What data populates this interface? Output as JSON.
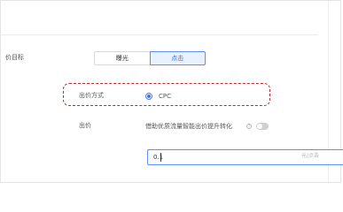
{
  "goal": {
    "label": "价目标",
    "options": [
      {
        "label": "曝光",
        "selected": false
      },
      {
        "label": "点击",
        "selected": true
      }
    ]
  },
  "bid_method": {
    "label": "出价方式",
    "option_label": "CPC",
    "highlight_color": "#c0282f"
  },
  "bid": {
    "label": "出价",
    "smart_label": "借助优质流量智能出价提升转化",
    "smart_enabled": false,
    "help_icon": "question-circle-icon",
    "input_value": "0.1",
    "unit_text": "元/点击"
  },
  "colors": {
    "accent": "#5b8ff9",
    "selected_bg": "#eaf1fe"
  }
}
